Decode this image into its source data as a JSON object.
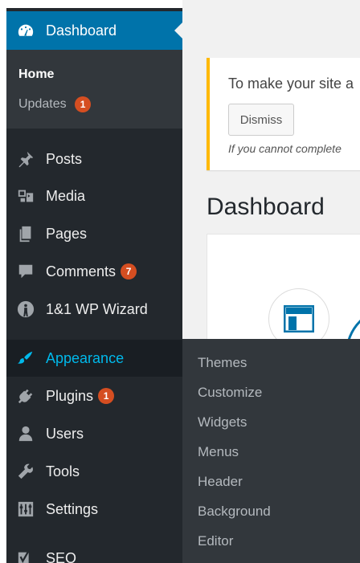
{
  "sidebar": {
    "dashboard": "Dashboard",
    "home": "Home",
    "updates": "Updates",
    "updates_badge": "1",
    "items": [
      {
        "label": "Posts",
        "icon": "pin-icon"
      },
      {
        "label": "Media",
        "icon": "media-icon"
      },
      {
        "label": "Pages",
        "icon": "pages-icon"
      },
      {
        "label": "Comments",
        "icon": "comment-icon",
        "badge": "7"
      },
      {
        "label": "1&1 WP Wizard",
        "icon": "wizard-icon"
      },
      {
        "label": "Appearance",
        "icon": "brush-icon"
      },
      {
        "label": "Plugins",
        "icon": "plugin-icon",
        "badge": "1"
      },
      {
        "label": "Users",
        "icon": "user-icon"
      },
      {
        "label": "Tools",
        "icon": "wrench-icon"
      },
      {
        "label": "Settings",
        "icon": "settings-icon"
      },
      {
        "label": "SEO",
        "icon": "seo-icon"
      }
    ]
  },
  "appearance_submenu": [
    "Themes",
    "Customize",
    "Widgets",
    "Menus",
    "Header",
    "Background",
    "Editor"
  ],
  "notice": {
    "text": "To make your site a",
    "dismiss": "Dismiss",
    "italic": "If you cannot complete"
  },
  "page_title": "Dashboard",
  "colors": {
    "sidebar_bg": "#23282d",
    "active_bg": "#0073aa",
    "submenu_bg": "#32373c",
    "badge": "#d54e21",
    "highlight_text": "#00b9eb",
    "notice_border": "#ffb900"
  }
}
